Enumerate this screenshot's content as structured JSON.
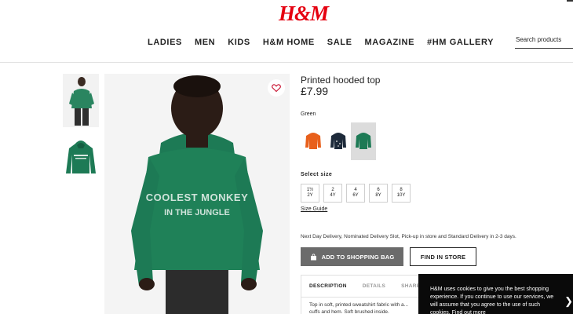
{
  "header": {
    "logo": "H&M",
    "nav": [
      "LADIES",
      "MEN",
      "KIDS",
      "H&M HOME",
      "SALE",
      "MAGAZINE",
      "#HM GALLERY"
    ],
    "search_placeholder": "Search products"
  },
  "product": {
    "hoodie_print": "COOLEST MONKEY IN THE JUNGLE",
    "title": "Printed hooded top",
    "price": "£7.99",
    "color_label": "Green",
    "swatch_colors": [
      "#e8601c",
      "#1d2a3a",
      "#1d7a55"
    ],
    "size_label": "Select size",
    "sizes": [
      {
        "top": "1½",
        "bottom": "2Y"
      },
      {
        "top": "2",
        "bottom": "4Y"
      },
      {
        "top": "4",
        "bottom": "6Y"
      },
      {
        "top": "6",
        "bottom": "8Y"
      },
      {
        "top": "8",
        "bottom": "10Y"
      }
    ],
    "size_guide": "Size Guide",
    "delivery": "Next Day Delivery, Nominated Delivery Slot, Pick-up in store and Standard Delivery in 2-3 days.",
    "add_to_bag": "ADD TO SHOPPING BAG",
    "find_in_store": "FIND IN STORE"
  },
  "tabs": {
    "items": [
      "DESCRIPTION",
      "DETAILS",
      "SHARE"
    ],
    "description": "Top in soft, printed sweatshirt fabric with a... cuffs and hem. Soft brushed inside."
  },
  "cookie": {
    "text": "H&M uses cookies to give you the best shopping experience. If you continue to use our services, we will assume that you agree to the use of such cookies. Find out more"
  },
  "colors": {
    "brand": "#e50010",
    "hoodie_green": "#1d7a55",
    "add_button": "#6b6b6b"
  }
}
